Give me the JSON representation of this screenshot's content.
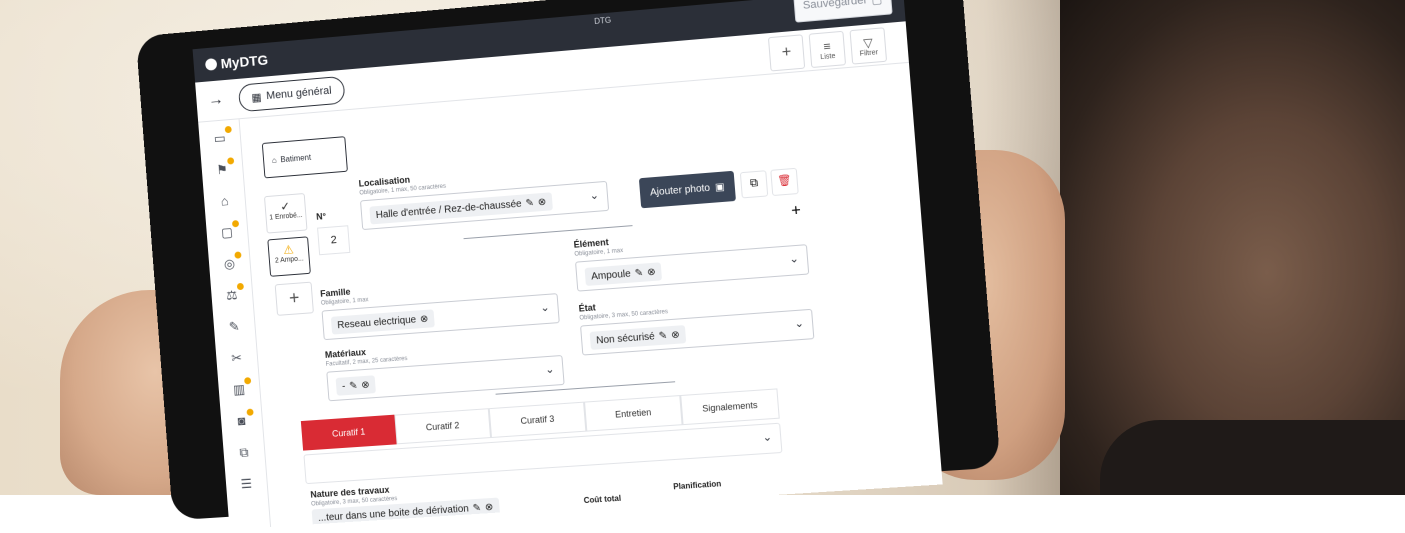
{
  "app": {
    "logo_text": "MyDTG",
    "window_title": "DTG",
    "save_label": "Sauvegarder"
  },
  "toolbar": {
    "menu_label": "Menu général",
    "add_label": "+",
    "list_label": "Liste",
    "filter_label": "Filtrer"
  },
  "sidebar": {
    "items": [
      "folder-icon",
      "flag-icon",
      "home-icon",
      "box-icon",
      "location-icon",
      "scale-icon",
      "tool-icon",
      "scissors-icon",
      "building-icon",
      "camera-icon",
      "stack-icon",
      "list-icon"
    ]
  },
  "building": {
    "label": "Batiment"
  },
  "steps": [
    {
      "label": "1 Enrobé..."
    },
    {
      "label": "2 Ampo..."
    }
  ],
  "form": {
    "no_label": "N°",
    "no_value": "2",
    "localisation": {
      "label": "Localisation",
      "hint": "Obligatoire, 1 max, 50 caractères",
      "value": "Halle d'entrée / Rez-de-chaussée"
    },
    "photo_label": "Ajouter photo",
    "famille": {
      "label": "Famille",
      "hint": "Obligatoire, 1 max",
      "value": "Reseau electrique"
    },
    "element": {
      "label": "Élément",
      "hint": "Obligatoire, 1 max",
      "value": "Ampoule"
    },
    "materiaux": {
      "label": "Matériaux",
      "hint": "Facultatif, 2 max, 25 caractères",
      "value": "-"
    },
    "etat": {
      "label": "État",
      "hint": "Obligatoire, 3 max, 50 caractères",
      "value": "Non sécurisé"
    },
    "nature": {
      "label": "Nature des travaux",
      "hint": "Obligatoire, 3 max, 50 caractères",
      "value": "...teur dans une boite de dérivation"
    },
    "cout_label": "Coût total",
    "planif_label": "Planification"
  },
  "tabs": [
    "Curatif 1",
    "Curatif 2",
    "Curatif 3",
    "Entretien",
    "Signalements"
  ],
  "colors": {
    "accent": "#d92b34",
    "dark": "#2b2f38",
    "badge": "#f2a900"
  }
}
